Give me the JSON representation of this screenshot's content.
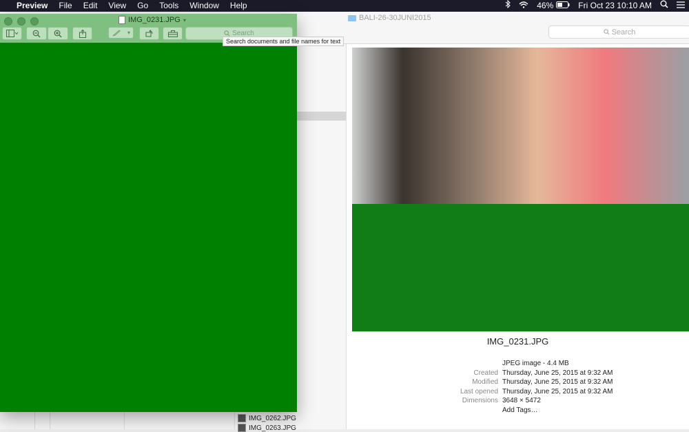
{
  "menubar": {
    "apple": "",
    "app": "Preview",
    "items": [
      "File",
      "Edit",
      "View",
      "Go",
      "Tools",
      "Window",
      "Help"
    ],
    "battery": "46%",
    "datetime": "Fri Oct 23  10:10 AM"
  },
  "finder": {
    "title": "BALI-26-30JUNI2015",
    "search_placeholder": "Search",
    "list_files": [
      "IMG_0262.JPG",
      "IMG_0263.JPG"
    ]
  },
  "info": {
    "filename": "IMG_0231.JPG",
    "kind": "JPEG image - 4.4 MB",
    "created_label": "Created",
    "created": "Thursday, June 25, 2015 at 9:32 AM",
    "modified_label": "Modified",
    "modified": "Thursday, June 25, 2015 at 9:32 AM",
    "opened_label": "Last opened",
    "opened": "Thursday, June 25, 2015 at 9:32 AM",
    "dims_label": "Dimensions",
    "dims": "3648 × 5472",
    "add_tags": "Add Tags…"
  },
  "preview": {
    "title": "IMG_0231.JPG",
    "search_placeholder": "Search",
    "tooltip": "Search documents and file names for text"
  },
  "colors": {
    "green": "#008000",
    "link": "#3478d6"
  },
  "icons": [
    "apple-icon",
    "bluetooth-icon",
    "wifi-icon",
    "battery-icon",
    "search-icon",
    "menu-icon",
    "sidebar-icon",
    "zoom-out-icon",
    "zoom-in-icon",
    "share-icon",
    "markup-icon",
    "rotate-icon",
    "toolbox-icon",
    "folder-icon",
    "document-icon"
  ]
}
